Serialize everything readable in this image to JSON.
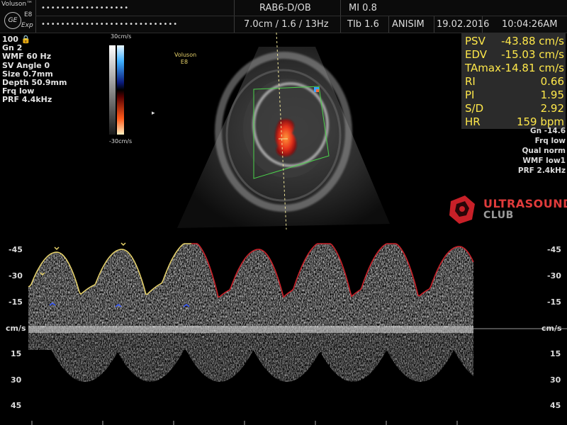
{
  "header": {
    "brand": "Voluson™",
    "logo_text": "GE",
    "model": "E8",
    "mode_tag": "Exp",
    "patient_name_mask": "••••••••••••••••••",
    "patient_id_mask": "••••••••••••••••••••••••••••",
    "probe": "RAB6-D/OB",
    "mi": "MI  0.8",
    "settings": "7.0cm / 1.6 / 13Hz",
    "tib": "TIb  1.6",
    "operator": "ANISIM",
    "date": "19.02.2016",
    "time": "10:04:26AM"
  },
  "left_params": [
    "100 🔒",
    "Gn  2",
    "WMF 60 Hz",
    "SV Angle  0",
    "Size  0.7mm",
    "Depth 50.9mm",
    "Frq low",
    "PRF  4.4kHz"
  ],
  "color_bar": {
    "top_label": "30cm/s",
    "bottom_label": "-30cm/s"
  },
  "image_label": {
    "line1": "Voluson",
    "line2": "E8"
  },
  "measurements": [
    {
      "label": "PSV",
      "value": "-43.88 cm/s"
    },
    {
      "label": "EDV",
      "value": "-15.03 cm/s"
    },
    {
      "label": "TAmax",
      "value": "-14.81 cm/s"
    },
    {
      "label": "RI",
      "value": "0.66"
    },
    {
      "label": "PI",
      "value": "1.95"
    },
    {
      "label": "S/D",
      "value": "2.92"
    },
    {
      "label": "HR",
      "value": "159 bpm"
    }
  ],
  "right_params": [
    "Gn -14.6",
    "Frq low",
    "Qual norm",
    "WMF low1",
    "PRF  2.4kHz"
  ],
  "watermark": {
    "line1": "ULTRASOUND",
    "line2": "CLUB"
  },
  "scale": {
    "ticks": [
      "-45",
      "-30",
      "-15",
      "cm/s",
      "15",
      "30",
      "45"
    ]
  },
  "colors": {
    "measure_text": "#ffe84a",
    "trace_yellow": "#e8d36a",
    "trace_red": "#c82028",
    "marker_blue": "#3a5cff",
    "accent_red": "#e03b3b"
  }
}
